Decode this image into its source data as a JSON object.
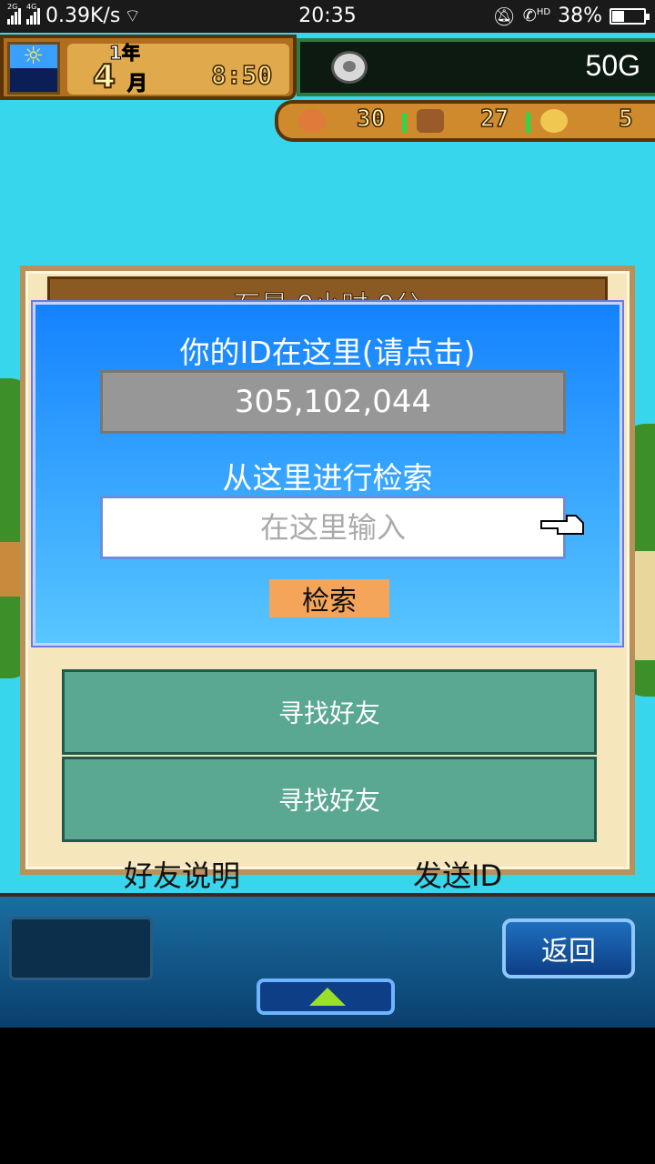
{
  "status_bar": {
    "network_label_1": "2G",
    "network_label_2": "4G",
    "speed": "0.39K/s",
    "time": "20:35",
    "hd_label": "HD",
    "battery": "38%",
    "battery_level": 0.38
  },
  "hud": {
    "year": "1年",
    "month": "4",
    "month_unit": "月",
    "clock": "8:50",
    "gold": "50G",
    "resources": [
      {
        "icon": "meat-icon",
        "value": "30"
      },
      {
        "icon": "wood-icon",
        "value": "27"
      },
      {
        "icon": "coin-icon",
        "value": "5"
      }
    ]
  },
  "panel": {
    "header": "石星 0小时 0分",
    "friend_rows": [
      "寻找好友",
      "寻找好友"
    ],
    "footer_left": "好友说明",
    "footer_right": "发送ID"
  },
  "dialog": {
    "id_title": "你的ID在这里(请点击)",
    "id_value": "305,102,044",
    "search_title": "从这里进行检索",
    "search_placeholder": "在这里输入",
    "search_button": "检索"
  },
  "bottom": {
    "back_button": "返回"
  }
}
